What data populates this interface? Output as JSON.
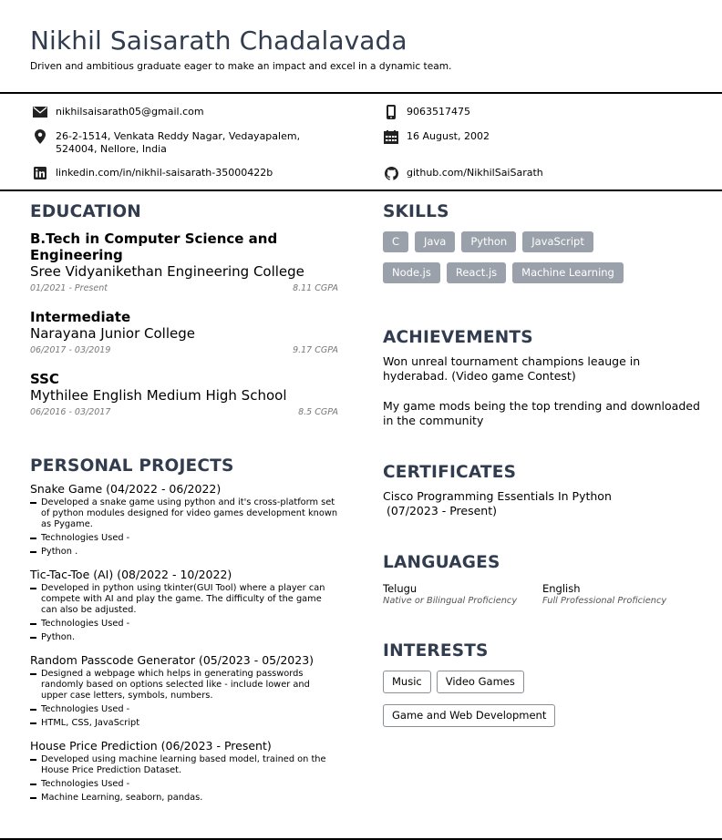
{
  "header": {
    "name": "Nikhil Saisarath Chadalavada",
    "tagline": "Driven and ambitious graduate eager to make an impact and excel in a dynamic team."
  },
  "contact": {
    "email": "nikhilsaisarath05@gmail.com",
    "phone": "9063517475",
    "address_line1": "26-2-1514, Venkata Reddy Nagar, Vedayapalem,",
    "address_line2": "524004, Nellore, India",
    "dob": "16 August, 2002",
    "linkedin": "linkedin.com/in/nikhil-saisarath-35000422b",
    "github": "github.com/NikhilSaiSarath"
  },
  "education": {
    "title": "EDUCATION",
    "items": [
      {
        "degree": "B.Tech in Computer Science and Engineering",
        "school": "Sree Vidyanikethan Engineering College",
        "dates": "01/2021 - Present",
        "score": "8.11 CGPA"
      },
      {
        "degree": "Intermediate",
        "school": "Narayana Junior College",
        "dates": "06/2017 - 03/2019",
        "score": "9.17 CGPA"
      },
      {
        "degree": "SSC",
        "school": "Mythilee English Medium High School",
        "dates": "06/2016 - 03/2017",
        "score": "8.5 CGPA"
      }
    ]
  },
  "projects": {
    "title": "PERSONAL PROJECTS",
    "items": [
      {
        "title": "Snake Game (04/2022 - 06/2022)",
        "b1": "Developed a snake game using python and it's cross-platform set of python modules designed for video games development known as Pygame.",
        "b2": "Technologies Used -",
        "b3": "Python ."
      },
      {
        "title": "Tic-Tac-Toe (AI) (08/2022 - 10/2022)",
        "b1": "Developed in python using tkinter(GUI Tool) where a player can compete with AI and play the game. The difficulty of the game can also be adjusted.",
        "b2": "Technologies Used -",
        "b3": "Python."
      },
      {
        "title": "Random Passcode Generator (05/2023 - 05/2023)",
        "b1": "Designed a webpage which helps in generating passwords randomly based on options selected like - include lower and upper case letters, symbols, numbers.",
        "b2": "Technologies Used -",
        "b3": "HTML, CSS, JavaScript"
      },
      {
        "title": "House Price Prediction (06/2023 - Present)",
        "b1": "Developed using machine learning based model, trained on the House Price Prediction Dataset.",
        "b2": "Technologies Used -",
        "b3": "Machine Learning, seaborn, pandas."
      }
    ]
  },
  "skills": {
    "title": "SKILLS",
    "items": [
      "C",
      "Java",
      "Python",
      "JavaScript",
      "Node.js",
      "React.js",
      "Machine Learning"
    ]
  },
  "achievements": {
    "title": "ACHIEVEMENTS",
    "items": [
      "Won unreal tournament champions leauge in hyderabad. (Video game Contest)",
      "My game mods being the top trending and downloaded in the community"
    ]
  },
  "certificates": {
    "title": "CERTIFICATES",
    "line1": "Cisco Programming Essentials In Python",
    "line2": " (07/2023 - Present)"
  },
  "languages": {
    "title": "LANGUAGES",
    "items": [
      {
        "name": "Telugu",
        "level": "Native or Bilingual Proficiency"
      },
      {
        "name": "English",
        "level": "Full Professional Proficiency"
      }
    ]
  },
  "interests": {
    "title": "INTERESTS",
    "items": [
      "Music",
      "Video Games",
      "Game and Web Development"
    ]
  },
  "colors": {
    "heading": "#313c4e",
    "skill_bg": "#9aa1aa",
    "muted": "#777777"
  },
  "icons": {
    "email": "envelope-icon",
    "phone": "mobile-phone-icon",
    "address": "map-pin-icon",
    "dob": "calendar-icon",
    "linkedin": "linkedin-icon",
    "github": "github-icon"
  }
}
